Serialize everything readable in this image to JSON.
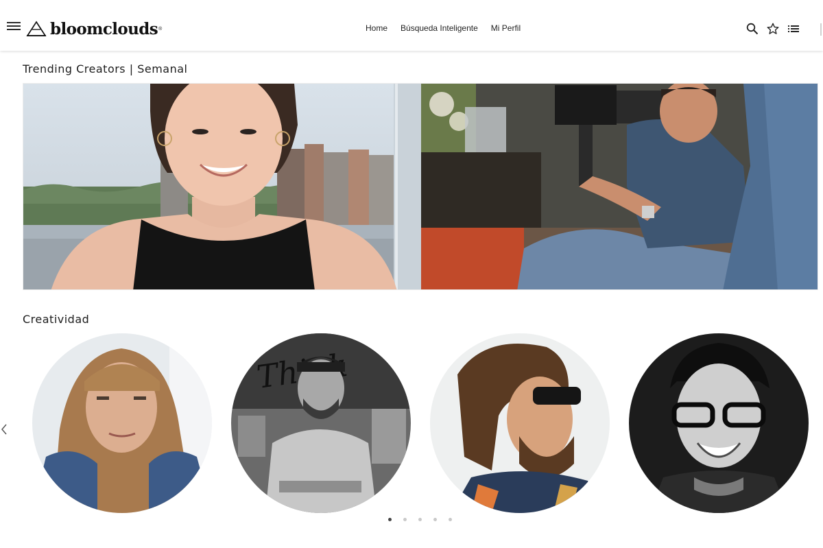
{
  "header": {
    "brand": "bloomclouds",
    "brand_mark": "®",
    "nav": [
      {
        "label": "Home"
      },
      {
        "label": "Búsqueda Inteligente"
      },
      {
        "label": "Mi Perfil"
      }
    ],
    "icons": [
      "menu-icon",
      "search-icon",
      "star-icon",
      "list-icon"
    ]
  },
  "sections": {
    "trending": {
      "title": "Trending Creators | Semanal"
    },
    "creativity": {
      "title": "Creatividad"
    }
  },
  "carousel": {
    "dots": 5,
    "active_dot": 1
  },
  "colors": {
    "accent": "#111111",
    "dot_active": "#444444",
    "dot_inactive": "#c9c9c9"
  }
}
